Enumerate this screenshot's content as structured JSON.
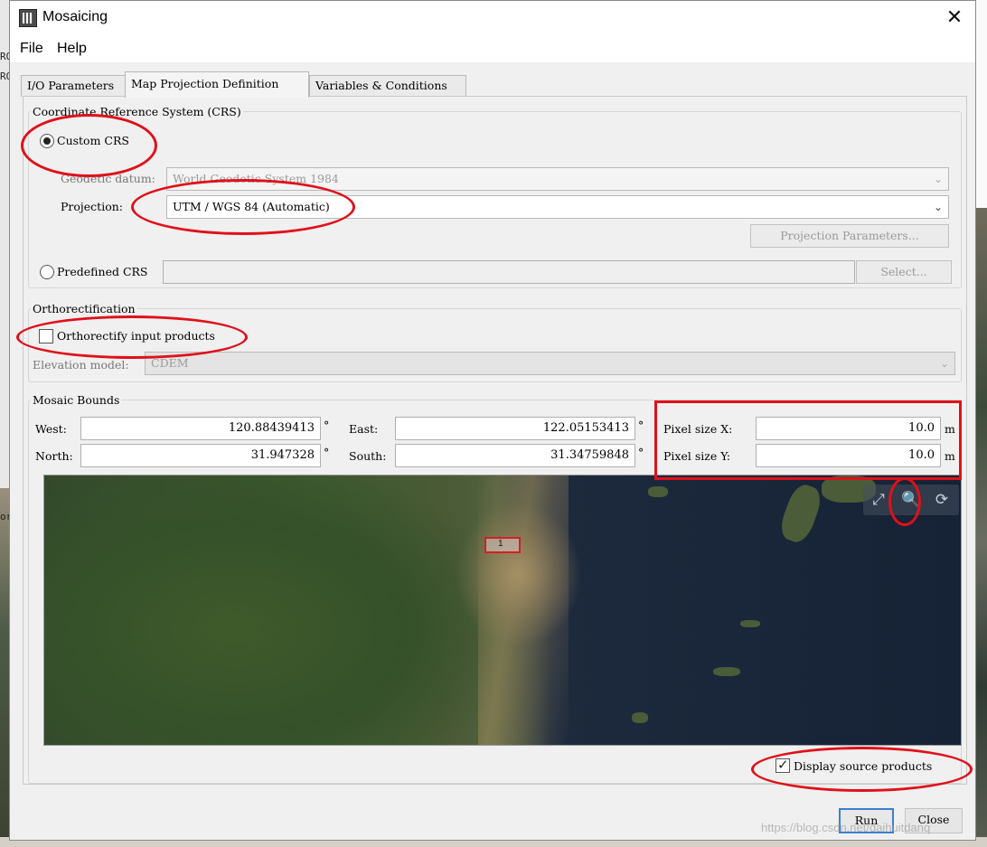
{
  "window": {
    "title": "Mosaicing",
    "close_glyph": "✕"
  },
  "menu": {
    "items": [
      "File",
      "Help"
    ]
  },
  "tabs": [
    {
      "label": "I/O Parameters",
      "active": false
    },
    {
      "label": "Map Projection Definition",
      "active": true
    },
    {
      "label": "Variables & Conditions",
      "active": false
    }
  ],
  "crs": {
    "legend": "Coordinate Reference System (CRS)",
    "custom_label": "Custom CRS",
    "custom_selected": true,
    "datum_label": "Geodetic datum:",
    "datum_value": "World Geodetic System 1984",
    "projection_label": "Projection:",
    "projection_value": "UTM / WGS 84 (Automatic)",
    "projection_params_button": "Projection Parameters...",
    "predefined_label": "Predefined CRS",
    "predefined_selected": false,
    "predefined_value": "",
    "select_button": "Select..."
  },
  "ortho": {
    "legend": "Orthorectification",
    "checkbox_label": "Orthorectify input products",
    "checked": false,
    "elevation_label": "Elevation model:",
    "elevation_value": "CDEM"
  },
  "bounds": {
    "legend": "Mosaic Bounds",
    "west_label": "West:",
    "west_value": "120.88439413",
    "east_label": "East:",
    "east_value": "122.05153413",
    "north_label": "North:",
    "north_value": "31.947328",
    "south_label": "South:",
    "south_value": "31.34759848",
    "degree_unit": "°",
    "pixel_x_label": "Pixel size X:",
    "pixel_x_value": "10.0",
    "pixel_y_label": "Pixel size Y:",
    "pixel_y_value": "10.0",
    "pixel_unit": "m"
  },
  "map": {
    "footprint_label": "1",
    "tools": [
      "zoom-all-icon",
      "zoom-tool-icon",
      "pan-tool-icon"
    ],
    "tool_glyphs": [
      "⤢",
      "🔍",
      "⟳"
    ]
  },
  "display_source": {
    "label": "Display source products",
    "checked": true
  },
  "buttons": {
    "run": "Run",
    "close": "Close"
  },
  "background": {
    "left_text_1": "RO",
    "left_text_2": "RO",
    "left_text_3": "or"
  },
  "watermark": "https://blog.csdn.net/daihuitdanq",
  "annotation_color": "#e0101a"
}
